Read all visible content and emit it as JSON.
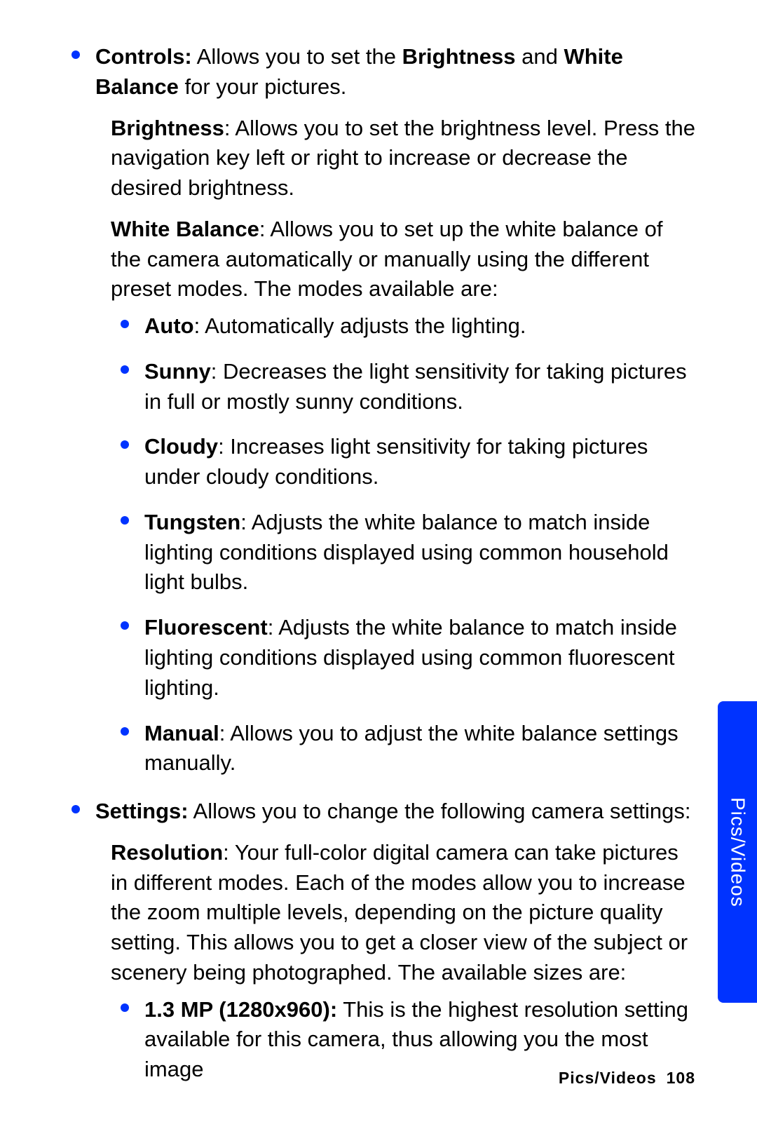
{
  "controls": {
    "lead_bold": "Controls:",
    "lead_text_1": " Allows you to set the ",
    "lead_bold_2": "Brightness",
    "lead_and": " and ",
    "lead_bold_3": "White Balance",
    "lead_tail": " for your pictures.",
    "brightness_label": "Brightness",
    "brightness_text": ": Allows you to set the brightness level. Press the navigation key left or right to increase or decrease the desired brightness.",
    "wb_label": "White Balance",
    "wb_text": ": Allows you to set up the white balance of the camera automatically or manually using the different preset modes. The modes available are:",
    "modes": [
      {
        "name": "Auto",
        "desc": ": Automatically adjusts the lighting."
      },
      {
        "name": "Sunny",
        "desc": ": Decreases the light sensitivity for taking pictures in full or mostly sunny conditions."
      },
      {
        "name": "Cloudy",
        "desc": ": Increases light sensitivity for taking pictures under cloudy conditions."
      },
      {
        "name": "Tungsten",
        "desc": ": Adjusts the white balance to match inside lighting conditions displayed using common household light bulbs."
      },
      {
        "name": "Fluorescent",
        "desc": ": Adjusts the white balance to match inside lighting conditions displayed using common fluorescent lighting."
      },
      {
        "name": "Manual",
        "desc": ": Allows you to adjust the white balance settings manually."
      }
    ]
  },
  "settings": {
    "lead_bold": "Settings:",
    "lead_text": " Allows you to change the following camera settings:",
    "res_label": "Resolution",
    "res_text": ": Your full-color digital camera can take pictures in different modes. Each of the modes allow you to increase the zoom multiple levels, depending on the picture quality setting. This allows you to get a closer view of the subject or scenery being photographed. The available sizes are:",
    "sizes": [
      {
        "name": "1.3 MP (1280x960):",
        "desc": " This is the highest resolution setting available for this camera, thus allowing you the most image"
      }
    ]
  },
  "side_tab": "Pics/Videos",
  "footer_section": "Pics/Videos",
  "footer_page": "108"
}
